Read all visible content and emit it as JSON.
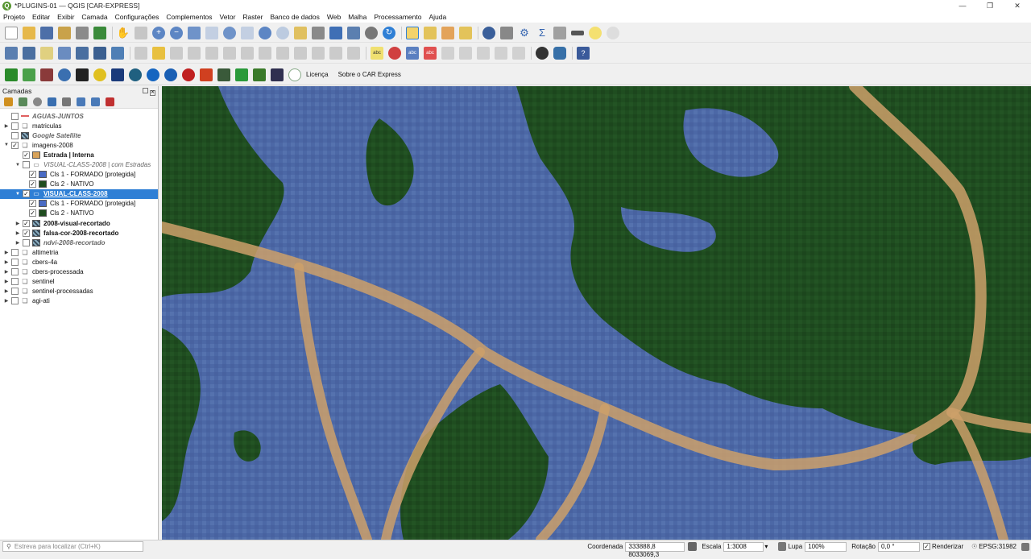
{
  "window": {
    "title": "*PLUGINS-01 — QGIS [CAR-EXPRESS]"
  },
  "menu": [
    "Projeto",
    "Editar",
    "Exibir",
    "Camada",
    "Configurações",
    "Complementos",
    "Vetor",
    "Raster",
    "Banco de dados",
    "Web",
    "Malha",
    "Processamento",
    "Ajuda"
  ],
  "plugins_bar": {
    "licenca": "Licença",
    "sobre": "Sobre o CAR Express"
  },
  "layers_panel": {
    "title": "Camadas",
    "items": [
      {
        "label": "AGUAS-JUNTOS"
      },
      {
        "label": "matriculas"
      },
      {
        "label": "Google Satellite"
      },
      {
        "label": "imagens-2008"
      },
      {
        "label": "Estrada | Interna"
      },
      {
        "label": "VISUAL-CLASS-2008 | com Estradas"
      },
      {
        "label": "Cls 1 - FORMADO [protegida]"
      },
      {
        "label": "Cls 2 - NATIVO"
      },
      {
        "label": "VISUAL-CLASS-2008"
      },
      {
        "label": "Cls 1 - FORMADO [protegida]"
      },
      {
        "label": "Cls 2 - NATIVO"
      },
      {
        "label": "2008-visual-recortado"
      },
      {
        "label": "falsa-cor-2008-recortado"
      },
      {
        "label": "ndvi-2008-recortado"
      },
      {
        "label": "altimetria"
      },
      {
        "label": "cbers-4a"
      },
      {
        "label": "cbers-processada"
      },
      {
        "label": "sentinel"
      },
      {
        "label": "sentinel-processadas"
      },
      {
        "label": "agi-ati"
      }
    ]
  },
  "colors": {
    "formado": "#4a6bc4",
    "nativo": "#1f4d1f",
    "estrada": "#d8a35a",
    "selection": "#2f7fd5"
  },
  "statusbar": {
    "search_placeholder": "Estreva para localizar (Ctrl+K)",
    "coord_label": "Coordenada",
    "coord_value": "333888,8  8033069,3",
    "scale_label": "Escala",
    "scale_value": "1:3008",
    "zoom_label": "Lupa",
    "zoom_value": "100%",
    "rotation_label": "Rotação",
    "rotation_value": "0,0 °",
    "render_label": "Renderizar",
    "crs": "EPSG:31982"
  }
}
